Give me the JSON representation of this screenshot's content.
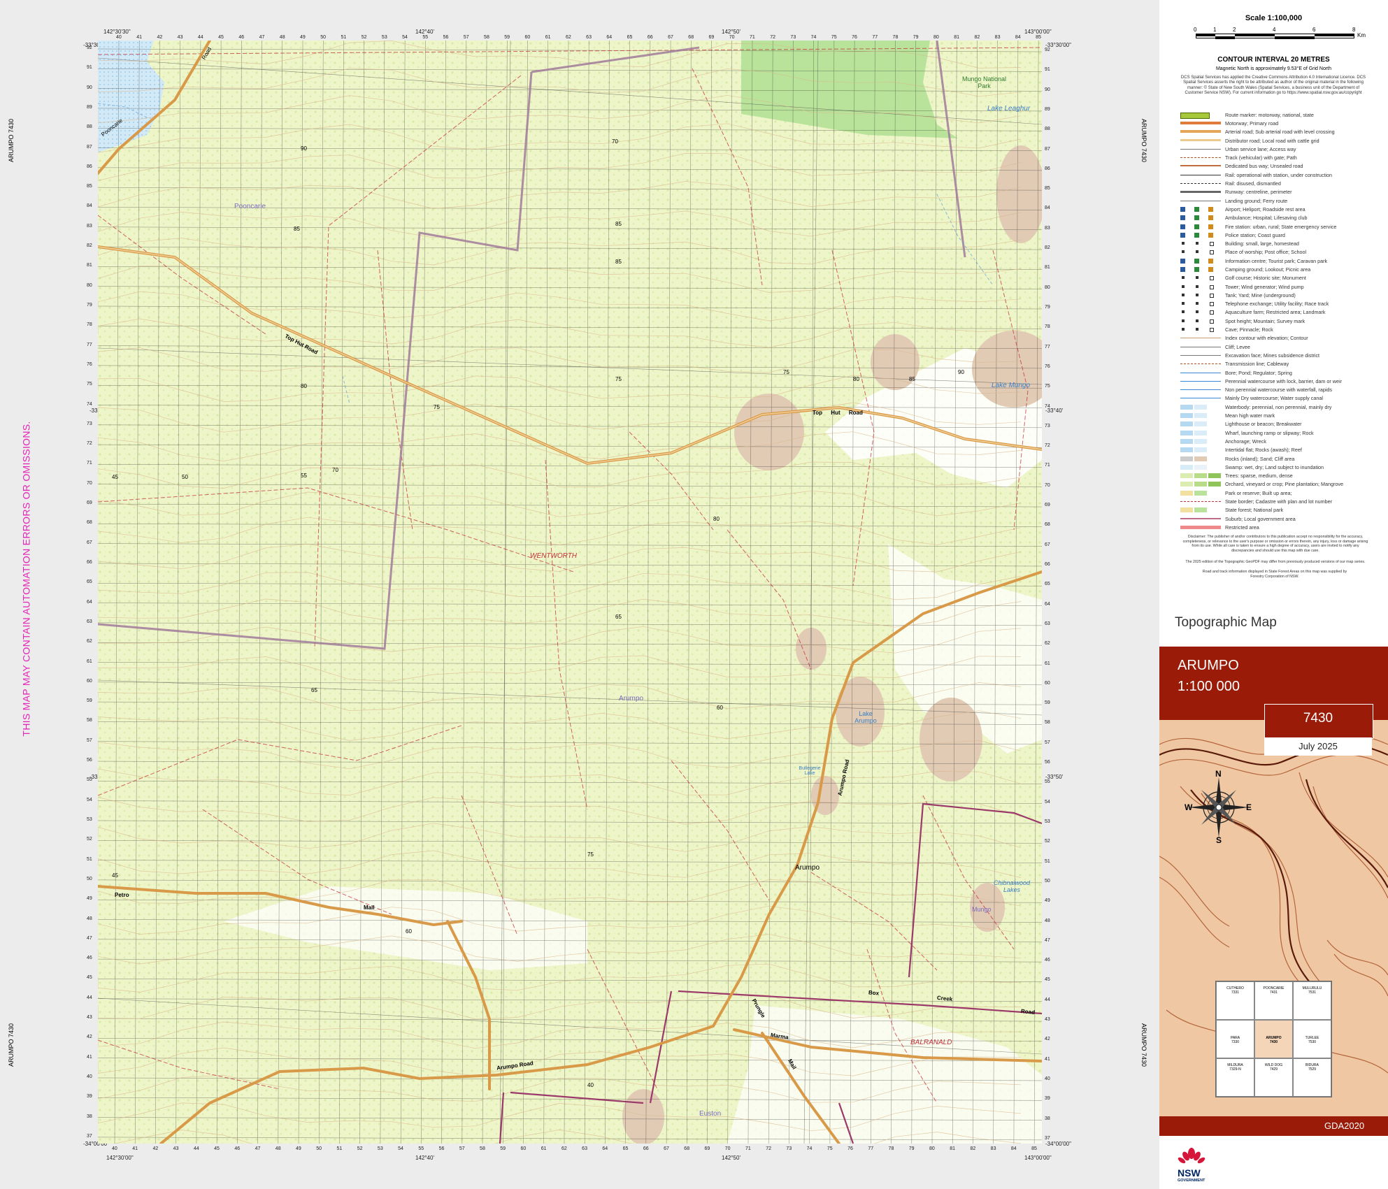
{
  "side_labels": {
    "left_top": "ARUMPO 7430",
    "left_bottom": "ARUMPO 7430",
    "right_top": "ARUMPO 7430",
    "right_bottom": "ARUMPO 7430",
    "warning": "THIS MAP MAY CONTAIN AUTOMATION ERRORS OR OMISSIONS."
  },
  "corners": {
    "top_left_lat": "-33°30'00\"",
    "top_left_lon": "142°30'30\"",
    "top_mid_lon1": "142°40'",
    "top_mid_lon2": "142°50'",
    "top_right_lon": "143°00'00\"",
    "top_right_lat": "-33°30'00\"",
    "left_lat_mid1": "-33°40'",
    "left_lat_mid2": "-33°50'",
    "right_lat_mid1": "-33°40'",
    "right_lat_mid2": "-33°50'",
    "bottom_left_lat": "-34°00'00\"",
    "bottom_left_lon": "142°30'00\"",
    "bottom_right_lat": "-34°00'00\"",
    "bottom_right_lon": "143°00'00\"",
    "bottom_mid_lon1": "142°40'",
    "bottom_mid_lon2": "142°50'"
  },
  "grid": {
    "top_eastings": [
      "40",
      "41",
      "42",
      "43",
      "44",
      "45",
      "46",
      "47",
      "48",
      "49",
      "50",
      "51",
      "52",
      "53",
      "54",
      "55",
      "56",
      "57",
      "58",
      "59",
      "60",
      "61",
      "62",
      "63",
      "64",
      "65",
      "66",
      "67",
      "68",
      "69",
      "70",
      "71",
      "72",
      "73",
      "74",
      "75",
      "76",
      "77",
      "78",
      "79",
      "80",
      "81",
      "82",
      "83",
      "84",
      "85"
    ],
    "left_northings": [
      "92",
      "91",
      "90",
      "89",
      "88",
      "87",
      "86",
      "85",
      "84",
      "83",
      "82",
      "81",
      "80",
      "79",
      "78",
      "77",
      "76",
      "75",
      "74",
      "73",
      "72",
      "71",
      "70",
      "69",
      "68",
      "67",
      "66",
      "65",
      "64",
      "63",
      "62",
      "61",
      "60",
      "59",
      "58",
      "57",
      "56",
      "55",
      "54",
      "53",
      "52",
      "51",
      "50",
      "49",
      "48",
      "47",
      "46",
      "45",
      "44",
      "43",
      "42",
      "41",
      "40",
      "39",
      "38",
      "37"
    ],
    "km_labels": {
      "top_left": "⁶40⁰⁰⁰mE",
      "top_right": "⁶29¹000mN",
      "mga": "(MGA 54)"
    }
  },
  "map_labels": {
    "pooncarie_road": "Pooncarie",
    "pooncarie_road2": "Road",
    "pooncarie_place": "Pooncarie",
    "top_hut_road_w": "Top Hut Road",
    "top_hut_road_e": "Top Hut Road",
    "wentworth": "WENTWORTH",
    "arumpo_locality": "Arumpo",
    "arumpo_town": "Arumpo",
    "arumpo_road": "Arumpo Road",
    "lake_arumpo": "Lake Arumpo",
    "lake_mungo": "Lake Mungo",
    "lake_leaghur": "Lake Leaghur",
    "mungo_np": "Mungo National Park",
    "chibnalwood": "Chibnalwood Lakes",
    "mungo_locality": "Mungo",
    "petro": "Petro",
    "mail": "Mail",
    "marma_box_creek_road": [
      "Marma",
      "Box",
      "Creek",
      "Road"
    ],
    "prungle_mail": [
      "Prungle",
      "Mail"
    ],
    "arumpo_road_s": "Arumpo Road",
    "balranald": "BALRANALD",
    "euston": "Euston",
    "bullenmerri": "Bullegerie Lake",
    "contour_labels": [
      "85",
      "80",
      "75",
      "70",
      "65",
      "60",
      "55",
      "50",
      "45",
      "40",
      "90"
    ]
  },
  "panel": {
    "scale_title": "Scale 1:100,000",
    "scale_ticks": [
      "0",
      "1",
      "2",
      "4",
      "6",
      "8"
    ],
    "scale_unit": "Km",
    "contour_interval": "CONTOUR INTERVAL 20 METRES",
    "magnetic": "Magnetic North is approximately 9.53°E of Grid North",
    "copyright": "DCS Spatial Services has applied the Creative Commons Attribution 4.0 International Licence. DCS Spatial Services asserts the right to be attributed as author of the original material in the following manner: © State of New South Wales (Spatial Services, a business unit of the Department of Customer Service NSW). For current information go to https://www.spatial.nsw.gov.au/copyright",
    "legend": [
      {
        "label": "Route marker: motorway, national, state",
        "sym": "route"
      },
      {
        "label": "Motorway; Primary road",
        "sym": "motorway"
      },
      {
        "label": "Arterial road; Sub arterial road with level crossing",
        "sym": "arterial"
      },
      {
        "label": "Distributor road; Local road with cattle grid",
        "sym": "distributor"
      },
      {
        "label": "Urban service lane; Access way",
        "sym": "thin"
      },
      {
        "label": "Track (vehicular) with gate; Path",
        "sym": "dash"
      },
      {
        "label": "Dedicated bus way; Unsealed road",
        "sym": "bus"
      },
      {
        "label": "Rail: operational with station, under construction",
        "sym": "rail"
      },
      {
        "label": "Rail: disused, dismantled",
        "sym": "rail2"
      },
      {
        "label": "Runway: centreline, perimeter",
        "sym": "runway"
      },
      {
        "label": "Landing ground; Ferry route",
        "sym": "thin"
      },
      {
        "label": "Airport; Heliport; Roadside rest area",
        "sym": "icons"
      },
      {
        "label": "Ambulance; Hospital; Lifesaving club",
        "sym": "icons"
      },
      {
        "label": "Fire station: urban, rural; State emergency service",
        "sym": "icons"
      },
      {
        "label": "Police station; Coast guard",
        "sym": "icons"
      },
      {
        "label": "Building: small, large, homestead",
        "sym": "icons2"
      },
      {
        "label": "Place of worship; Post office; School",
        "sym": "icons2"
      },
      {
        "label": "Information centre; Tourist park; Caravan park",
        "sym": "icons"
      },
      {
        "label": "Camping ground; Lookout; Picnic area",
        "sym": "icons"
      },
      {
        "label": "Golf course; Historic site; Monument",
        "sym": "icons2"
      },
      {
        "label": "Tower; Wind generator; Wind pump",
        "sym": "icons2"
      },
      {
        "label": "Tank; Yard; Mine (underground)",
        "sym": "icons2"
      },
      {
        "label": "Telephone exchange; Utility facility; Race track",
        "sym": "icons2"
      },
      {
        "label": "Aquaculture farm; Restricted area; Landmark",
        "sym": "icons2"
      },
      {
        "label": "Spot height; Mountain; Survey mark",
        "sym": "icons2"
      },
      {
        "label": "Cave; Pinnacle; Rock",
        "sym": "icons2"
      },
      {
        "label": "Index contour with elevation; Contour",
        "sym": "contour"
      },
      {
        "label": "Cliff; Levee",
        "sym": "thin"
      },
      {
        "label": "Excavation face; Mines subsidence district",
        "sym": "thin"
      },
      {
        "label": "Transmission line; Cableway",
        "sym": "dash"
      },
      {
        "label": "Bore; Pond; Regulator; Spring",
        "sym": "water"
      },
      {
        "label": "Perennial watercourse with lock, barrier, dam or weir",
        "sym": "water"
      },
      {
        "label": "Non perennial watercourse with waterfall, rapids",
        "sym": "water"
      },
      {
        "label": "Mainly Dry watercourse; Water supply canal",
        "sym": "water"
      },
      {
        "label": "Waterbody: perennial, non perennial, mainly dry",
        "sym": "waterbody"
      },
      {
        "label": "Mean high water mark",
        "sym": "waterbody"
      },
      {
        "label": "Lighthouse or beacon; Breakwater",
        "sym": "waterbody"
      },
      {
        "label": "Wharf, launching ramp or slipway; Rock",
        "sym": "waterbody"
      },
      {
        "label": "Anchorage; Wreck",
        "sym": "waterbody"
      },
      {
        "label": "Intertidal flat; Rocks (awash); Reef",
        "sym": "waterbody"
      },
      {
        "label": "Rocks (inland); Sand; Cliff area",
        "sym": "sand"
      },
      {
        "label": "Swamp: wet, dry; Land subject to inundation",
        "sym": "swamp"
      },
      {
        "label": "Trees: sparse, medium, dense",
        "sym": "trees"
      },
      {
        "label": "Orchard, vineyard or crop; Pine plantation; Mangrove",
        "sym": "trees"
      },
      {
        "label": "Park or reserve; Built up area;",
        "sym": "park"
      },
      {
        "label": "State border; Cadastre with plan and lot number",
        "sym": "border"
      },
      {
        "label": "State forest; National park",
        "sym": "park"
      },
      {
        "label": "Suburb; Local government area",
        "sym": "lga"
      },
      {
        "label": "Restricted area",
        "sym": "restricted"
      }
    ],
    "disclaimer": "Disclaimer: The publisher of and/or contributors to this publication accept no responsibility for the accuracy, completeness, or relevance to the user's purpose or omission or errors therein, any injury, loss or damage arising from its use. While all care is taken to ensure a high degree of accuracy, users are invited to notify any discrepancies and should use this map with due care.",
    "edition_note": "The 2025 edition of the Topographic GeoPDF may differ from previously produced versions of our map series.",
    "forestry_note": "Road and track information displayed in State Forest Areas on this map was supplied by Forestry Corporation of NSW.",
    "topo_title": "Topographic Map",
    "map_name": "ARUMPO",
    "map_scale": "1:100 000",
    "map_number": "7430",
    "map_date": "July 2025",
    "compass": [
      "N",
      "E",
      "S",
      "W"
    ],
    "index": {
      "cells": [
        [
          "CUTHERO\n7331",
          "POONCARIE\n7431",
          "MULURULU\n7531"
        ],
        [
          "PARA\n7330",
          "ARUMPO\n7430",
          "TURLEE\n7530"
        ],
        [
          "MILDURA\n7329-N",
          "WILD DOG\n7429",
          "BIDURA\n7529"
        ]
      ]
    },
    "datum": "GDA2020",
    "agency": "NSW",
    "agency_sub": "GOVERNMENT"
  },
  "colors": {
    "vegetation": "#eef5c8",
    "park": "#b9e39a",
    "sand": "#e1cbb5",
    "road": "#d89a48",
    "cadastre": "#c4313a",
    "title_red": "#9a1c08",
    "index_box": "#efc7a3",
    "warning": "#e524b8"
  }
}
